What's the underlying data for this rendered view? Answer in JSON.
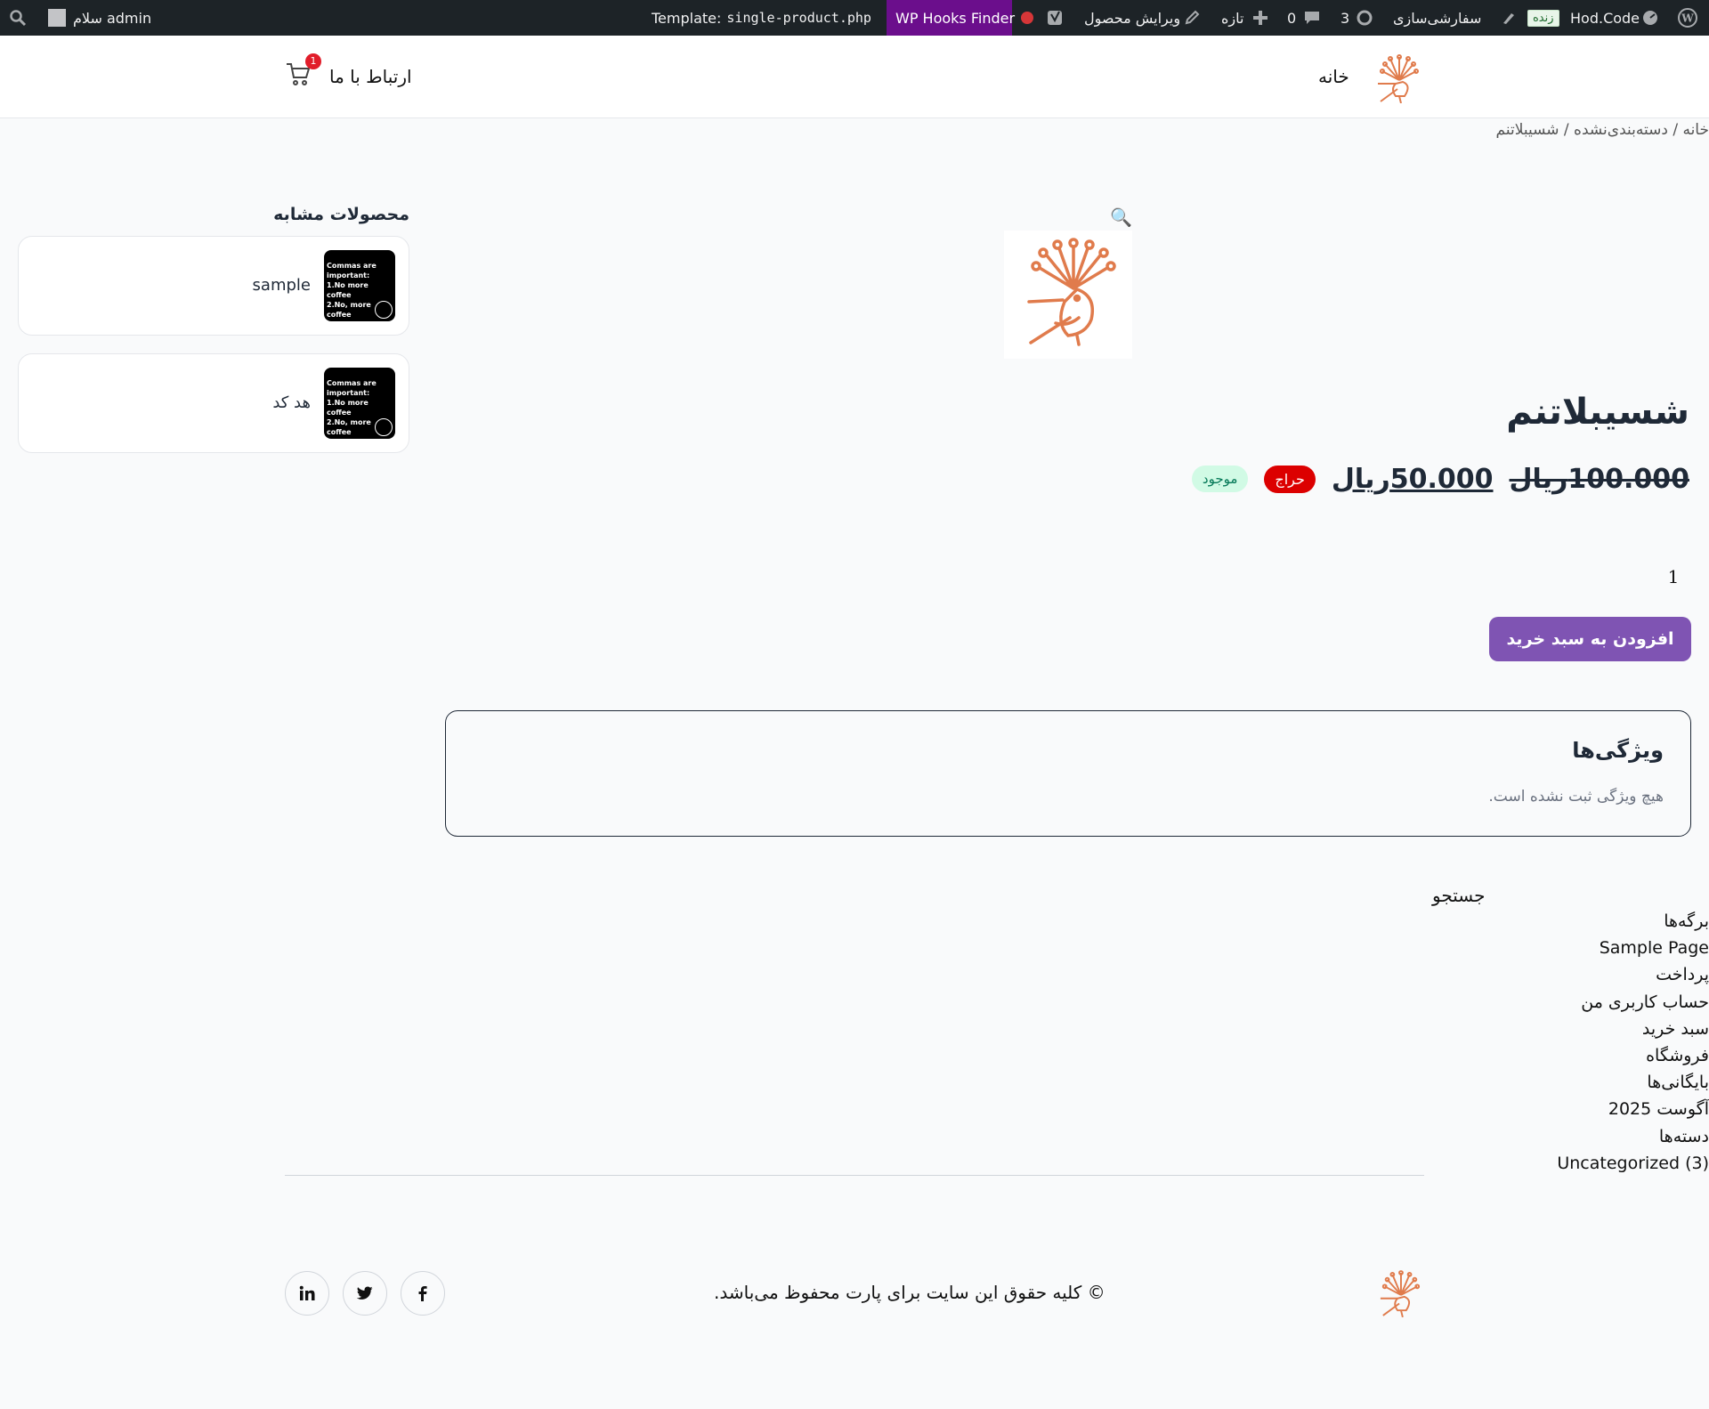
{
  "admin_bar": {
    "template_prefix": "Template:",
    "template_file": "single-product.php",
    "hooks_finder": "WP Hooks Finder",
    "edit_product": "ویرایش محصول",
    "new": "تازه",
    "comments_count": "0",
    "updates_count": "3",
    "customize": "سفارشی‌سازی",
    "live_badge": "زنده",
    "site_name": "Hod.Code",
    "greeting": "سلام admin"
  },
  "header": {
    "nav_home": "خانه",
    "nav_contact": "ارتباط با ما",
    "cart_count": "1"
  },
  "breadcrumb": "خانه / دسته‌بندی‌نشده / شسیبلاتنم",
  "product": {
    "title": "شسیبلاتنم",
    "old_price": "100.000ریال",
    "new_price": "50.000ریال",
    "sale_badge": "حراج",
    "stock_badge": "موجود",
    "quantity": "1",
    "add_to_cart": "افزودن به سبد خرید"
  },
  "features": {
    "title": "ویژگی‌ها",
    "empty_text": "هیچ ویژگی ثبت نشده است."
  },
  "related": {
    "title": "محصولات مشابه",
    "items": [
      {
        "name": "sample",
        "thumb_lines": [
          "Commas are",
          "important:",
          "1.No more coffee",
          "2.No, more coffee"
        ]
      },
      {
        "name": "هد کد",
        "thumb_lines": [
          "Commas are",
          "important:",
          "1.No more coffee",
          "2.No, more coffee"
        ]
      }
    ]
  },
  "widgets": {
    "search_label": "جستجو",
    "pages_title": "برگه‌ها",
    "pages": [
      "Sample Page",
      "پرداخت",
      "حساب کاربری من",
      "سبد خرید",
      "فروشگاه"
    ],
    "archives_title": "بایگانی‌ها",
    "archives": [
      "آگوست 2025"
    ],
    "categories_title": "دسته‌ها",
    "categories": [
      "Uncategorized (3)"
    ]
  },
  "footer": {
    "copyright": "© کلیه حقوق این سایت برای پارت محفوظ می‌باشد."
  },
  "icons": {
    "wp_logo": "wordpress-icon",
    "search": "search-icon",
    "cart": "cart-icon",
    "social": [
      "linkedin-icon",
      "twitter-icon",
      "facebook-icon"
    ]
  },
  "colors": {
    "accent_purple": "#7f54b3",
    "sale_red": "#dc0000",
    "logo_orange": "#e07b4c",
    "admin_bar": "#1d2327"
  }
}
